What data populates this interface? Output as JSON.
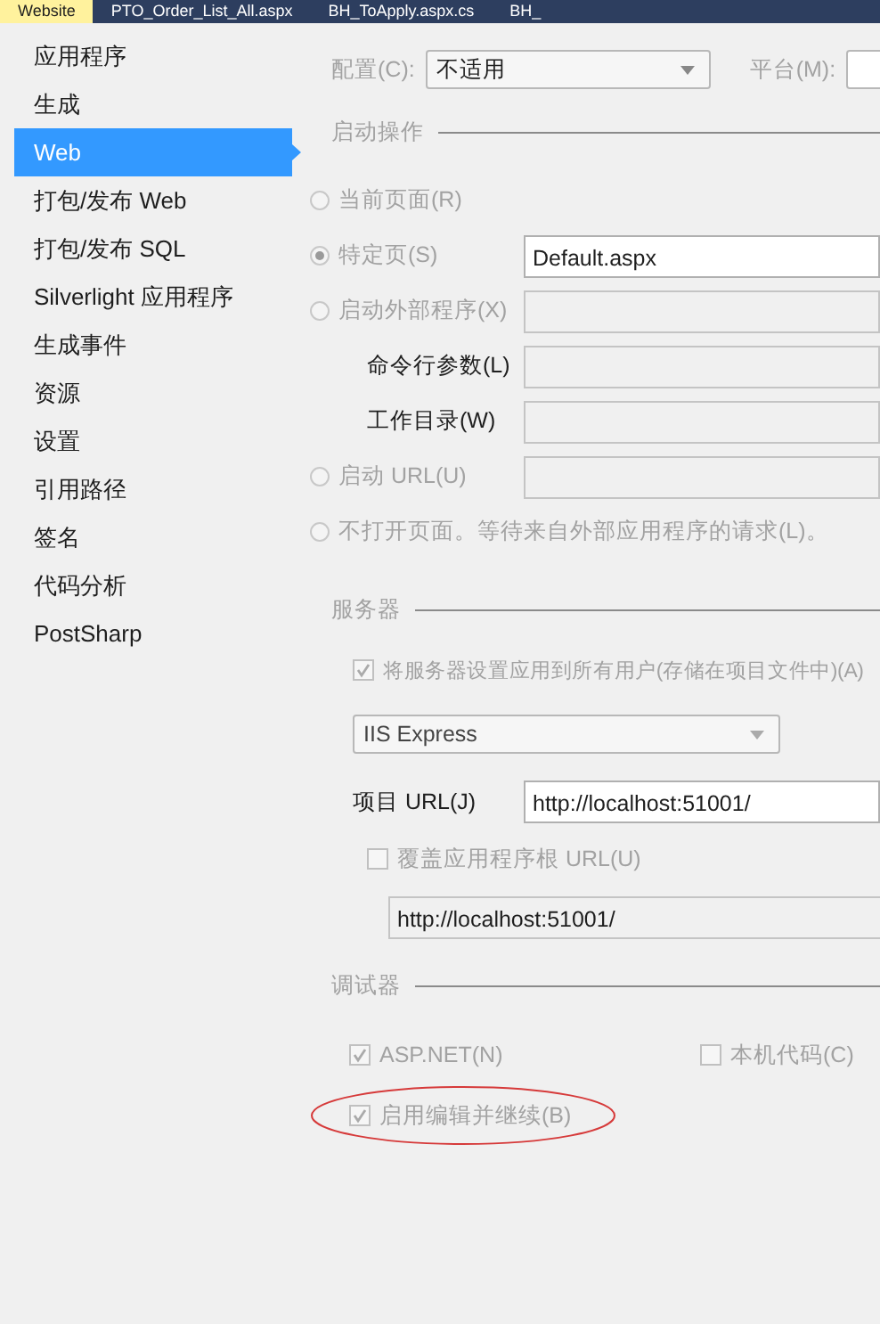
{
  "tabs": [
    {
      "label": "Website",
      "selected": true
    },
    {
      "label": "PTO_Order_List_All.aspx",
      "selected": false
    },
    {
      "label": "BH_ToApply.aspx.cs",
      "selected": false
    },
    {
      "label": "BH_",
      "selected": false
    }
  ],
  "sidebar": {
    "items": [
      {
        "label": "应用程序",
        "selected": false
      },
      {
        "label": "生成",
        "selected": false
      },
      {
        "label": "Web",
        "selected": true
      },
      {
        "label": "打包/发布 Web",
        "selected": false
      },
      {
        "label": "打包/发布 SQL",
        "selected": false
      },
      {
        "label": "Silverlight 应用程序",
        "selected": false
      },
      {
        "label": "生成事件",
        "selected": false
      },
      {
        "label": "资源",
        "selected": false
      },
      {
        "label": "设置",
        "selected": false
      },
      {
        "label": "引用路径",
        "selected": false
      },
      {
        "label": "签名",
        "selected": false
      },
      {
        "label": "代码分析",
        "selected": false
      },
      {
        "label": "PostSharp",
        "selected": false
      }
    ]
  },
  "config": {
    "label": "配置(C):",
    "value": "不适用"
  },
  "platform": {
    "label": "平台(M):"
  },
  "start_action": {
    "title": "启动操作",
    "rows": [
      {
        "kind": "radio",
        "label": "当前页面(R)",
        "selected": false
      },
      {
        "kind": "radio",
        "label": "特定页(S)",
        "selected": true,
        "field": {
          "value": "Default.aspx",
          "disabled": false
        }
      },
      {
        "kind": "radio",
        "label": "启动外部程序(X)",
        "selected": false,
        "field": {
          "disabled": true
        }
      },
      {
        "kind": "label",
        "label": "命令行参数(L)",
        "field": {
          "disabled": true
        }
      },
      {
        "kind": "label",
        "label": "工作目录(W)",
        "field": {
          "disabled": true
        }
      },
      {
        "kind": "radio",
        "label": "启动 URL(U)",
        "selected": false,
        "field": {
          "disabled": true
        }
      },
      {
        "kind": "radio",
        "label": "不打开页面。等待来自外部应用程序的请求(L)。",
        "selected": false
      }
    ]
  },
  "server": {
    "title": "服务器",
    "apply_all": {
      "label": "将服务器设置应用到所有用户(存储在项目文件中)(A)",
      "checked": true
    },
    "server_type": "IIS Express",
    "project_url": {
      "label": "项目 URL(J)",
      "value": "http://localhost:51001/"
    },
    "override_root": {
      "label": "覆盖应用程序根 URL(U)",
      "checked": false
    },
    "override_url": "http://localhost:51001/"
  },
  "debugger": {
    "title": "调试器",
    "checks": [
      {
        "label": "ASP.NET(N)",
        "checked": true,
        "annotated": false
      },
      {
        "label": "本机代码(C)",
        "checked": false,
        "annotated": false
      },
      {
        "label": "启用编辑并继续(B)",
        "checked": true,
        "annotated": true
      }
    ]
  }
}
